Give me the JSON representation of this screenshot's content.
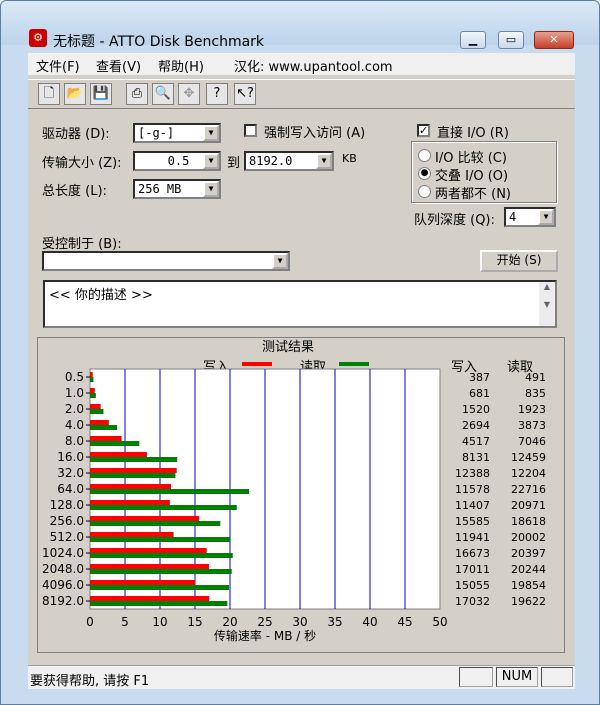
{
  "window": {
    "title": "无标题 - ATTO Disk Benchmark",
    "minimize": "▁",
    "maximize": "▭",
    "close": "✕"
  },
  "menu": {
    "file": "文件(F)",
    "view": "查看(V)",
    "help": "帮助(H)",
    "credit": "汉化: www.upantool.com"
  },
  "toolbar": {
    "icons": [
      "new-icon",
      "open-icon",
      "save-icon",
      "print-icon",
      "print-preview-icon",
      "move-icon",
      "help-icon",
      "context-help-icon"
    ]
  },
  "form": {
    "drive_label": "驱动器 (D):",
    "drive_value": "[-g-]",
    "transfer_label": "传输大小 (Z):",
    "transfer_from": "0.5",
    "to_label": "到",
    "transfer_to": "8192.0",
    "kb_label": "KB",
    "total_label": "总长度 (L):",
    "total_value": "256 MB",
    "force_write_label": "强制写入访问 (A)",
    "force_write_checked": false,
    "direct_io_label": "直接 I/O (R)",
    "direct_io_checked": true,
    "io_compare_label": "I/O 比较 (C)",
    "overlap_io_label": "交叠 I/O (O)",
    "neither_label": "两者都不 (N)",
    "selected_mode": "overlap",
    "queue_label": "队列深度 (Q):",
    "queue_value": "4",
    "controlled_label": "受控制于 (B):",
    "controlled_value": "",
    "start_button": "开始 (S)",
    "description": "<<  你的描述  >>"
  },
  "results": {
    "title": "测试结果",
    "legend_write": "写入",
    "legend_read": "读取",
    "col_write": "写入",
    "col_read": "读取"
  },
  "colors": {
    "write": "#ff0000",
    "read": "#008000",
    "grid": "#0000cc"
  },
  "chart_data": {
    "type": "bar",
    "orientation": "horizontal",
    "categories": [
      "0.5",
      "1.0",
      "2.0",
      "4.0",
      "8.0",
      "16.0",
      "32.0",
      "64.0",
      "128.0",
      "256.0",
      "512.0",
      "1024.0",
      "2048.0",
      "4096.0",
      "8192.0"
    ],
    "series": [
      {
        "name": "写入",
        "values": [
          387,
          681,
          1520,
          2694,
          4517,
          8131,
          12388,
          11578,
          11407,
          15585,
          11941,
          16673,
          17011,
          15055,
          17032
        ]
      },
      {
        "name": "读取",
        "values": [
          491,
          835,
          1923,
          3873,
          7046,
          12459,
          12204,
          22716,
          20971,
          18618,
          20002,
          20397,
          20244,
          19854,
          19622
        ]
      }
    ],
    "xlabel": "传输速率 - MB / 秒",
    "xlim": [
      0,
      50
    ],
    "xticks": [
      "0",
      "5",
      "10",
      "15",
      "20",
      "25",
      "30",
      "35",
      "40",
      "45",
      "50"
    ],
    "grid": true
  },
  "status": {
    "text": "要获得帮助, 请按 F1",
    "num": "NUM"
  }
}
